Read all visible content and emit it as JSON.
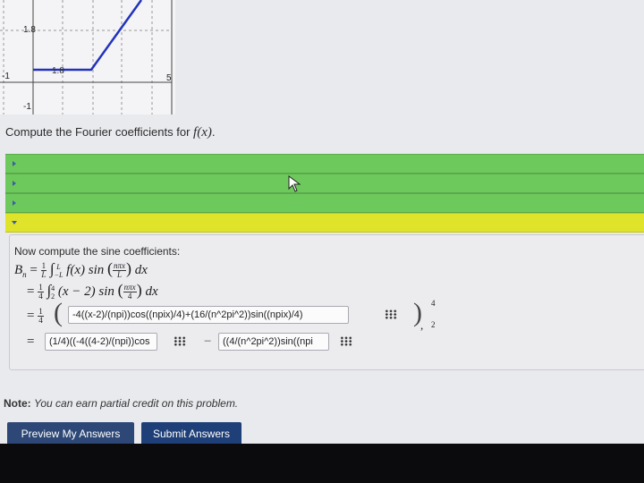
{
  "graph": {
    "y_tick_top": "1.8",
    "y_tick_mid": "1.8",
    "x_tick_left": "-1",
    "x_tick_right": "5",
    "y_tick_bottom": "-1",
    "line_color": "#2233bb"
  },
  "prompt": {
    "text": "Compute the Fourier coefficients for",
    "func": "f(x)",
    "end": "."
  },
  "accordion": {
    "colors": {
      "done": "#6ec95c",
      "active": "#dfe32a"
    },
    "sections": [
      {
        "state": "collapsed",
        "icon": "triangle-right-icon"
      },
      {
        "state": "collapsed",
        "icon": "triangle-right-icon"
      },
      {
        "state": "collapsed",
        "icon": "triangle-right-icon"
      },
      {
        "state": "expanded",
        "icon": "triangle-down-icon"
      }
    ]
  },
  "work": {
    "heading": "Now compute the sine coefficients:",
    "line1": {
      "lhs": "B",
      "sub": "n",
      "eq": "=",
      "one": "1",
      "L": "L",
      "int_sym": "∫",
      "int_upper": "L",
      "int_lower": "−L",
      "fx": "f(x) sin",
      "arg_num": "nπx",
      "arg_den": "L",
      "dx": "dx"
    },
    "line2": {
      "eq": "=",
      "one": "1",
      "den": "4",
      "int_sym": "∫",
      "int_upper": "4",
      "int_lower": "2",
      "expr": "(x − 2) sin",
      "arg_num": "nπx",
      "arg_den": "4",
      "dx": "dx"
    },
    "line3": {
      "eq": "=",
      "one": "1",
      "den": "4",
      "answer": "-4((x-2)/(npi))cos((npix)/4)+(16/(n^2pi^2))sin((npix)/4)",
      "eval_upper": "4",
      "eval_lower": "2",
      "tail": ","
    },
    "line4": {
      "eq": "=",
      "answer_a": "(1/4)((-4((4-2)/(npi))cos",
      "minus": "−",
      "answer_b": "((4/(n^2pi^2))sin((npi"
    },
    "grid_icon": "equation-editor-icon"
  },
  "note": {
    "label": "Note:",
    "text": "You can earn partial credit on this problem."
  },
  "buttons": {
    "preview": "Preview My Answers",
    "submit": "Submit Answers"
  }
}
